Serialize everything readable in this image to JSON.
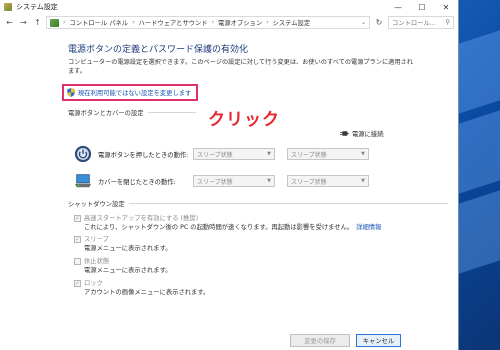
{
  "window": {
    "title": "システム設定",
    "controls": {
      "minimize": "—",
      "maximize": "☐",
      "close": "✕"
    }
  },
  "addressbar": {
    "back": "←",
    "forward": "→",
    "up": "↑",
    "breadcrumb": [
      "コントロール パネル",
      "ハードウェアとサウンド",
      "電源オプション",
      "システム設定"
    ],
    "separator": "›",
    "dropdown": "⌄",
    "refresh": "↻",
    "search_placeholder": "コントロール...",
    "search_icon": "⚲"
  },
  "main": {
    "title": "電源ボタンの定義とパスワード保護の有効化",
    "description": "コンピューターの電源設定を選択できます。このページの設定に対して行う変更は、お使いのすべての電源プランに適用されます。",
    "uac_link": "現在利用可能ではない設定を変更します",
    "annotation": "クリック"
  },
  "power_buttons": {
    "header": "電源ボタンとカバーの設定",
    "column_header": "電源に接続",
    "rows": [
      {
        "label": "電源ボタンを押したときの動作:",
        "battery": "スリープ状態",
        "plugged": "スリープ状態"
      },
      {
        "label": "カバーを閉じたときの動作:",
        "battery": "スリープ状態",
        "plugged": "スリープ状態"
      }
    ]
  },
  "shutdown": {
    "header": "シャットダウン設定",
    "items": [
      {
        "label": "高速スタートアップを有効にする (推奨)",
        "checked": true,
        "desc": "これにより、シャットダウン後の PC の起動時間が速くなります。再起動は影響を受けません。",
        "more": "詳細情報"
      },
      {
        "label": "スリープ",
        "checked": true,
        "desc": "電源メニューに表示されます。"
      },
      {
        "label": "休止状態",
        "checked": false,
        "desc": "電源メニューに表示されます。"
      },
      {
        "label": "ロック",
        "checked": true,
        "desc": "アカウントの画像メニューに表示されます。"
      }
    ]
  },
  "footer": {
    "save": "変更の保存",
    "cancel": "キャンセル"
  },
  "colors": {
    "accent": "#1e3c78",
    "link": "#1a56b8",
    "highlight_border": "#e0306a",
    "annotation": "#e8262e"
  }
}
